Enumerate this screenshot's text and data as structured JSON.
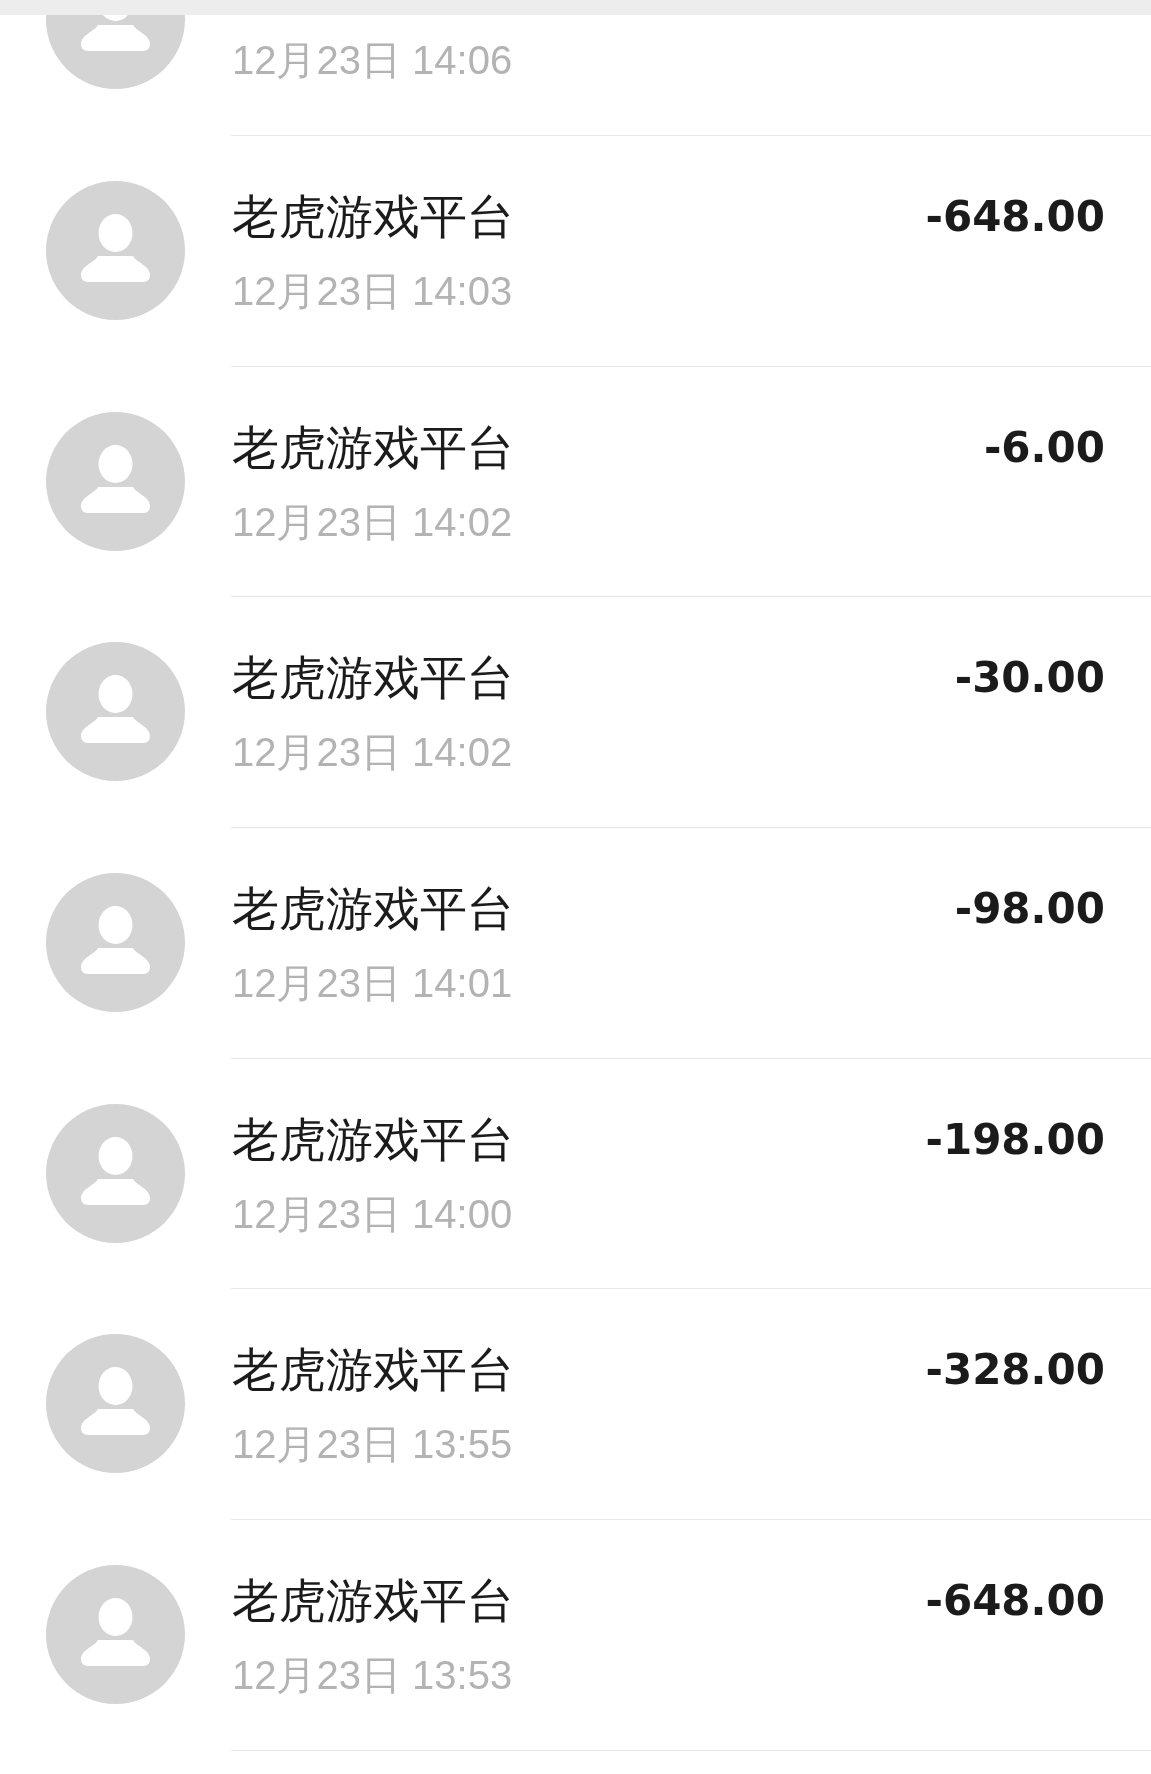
{
  "transactions": [
    {
      "time": "12月23日 14:06"
    },
    {
      "name": "老虎游戏平台",
      "amount": "-648.00",
      "time": "12月23日 14:03"
    },
    {
      "name": "老虎游戏平台",
      "amount": "-6.00",
      "time": "12月23日 14:02"
    },
    {
      "name": "老虎游戏平台",
      "amount": "-30.00",
      "time": "12月23日 14:02"
    },
    {
      "name": "老虎游戏平台",
      "amount": "-98.00",
      "time": "12月23日 14:01"
    },
    {
      "name": "老虎游戏平台",
      "amount": "-198.00",
      "time": "12月23日 14:00"
    },
    {
      "name": "老虎游戏平台",
      "amount": "-328.00",
      "time": "12月23日 13:55"
    },
    {
      "name": "老虎游戏平台",
      "amount": "-648.00",
      "time": "12月23日 13:53"
    }
  ]
}
